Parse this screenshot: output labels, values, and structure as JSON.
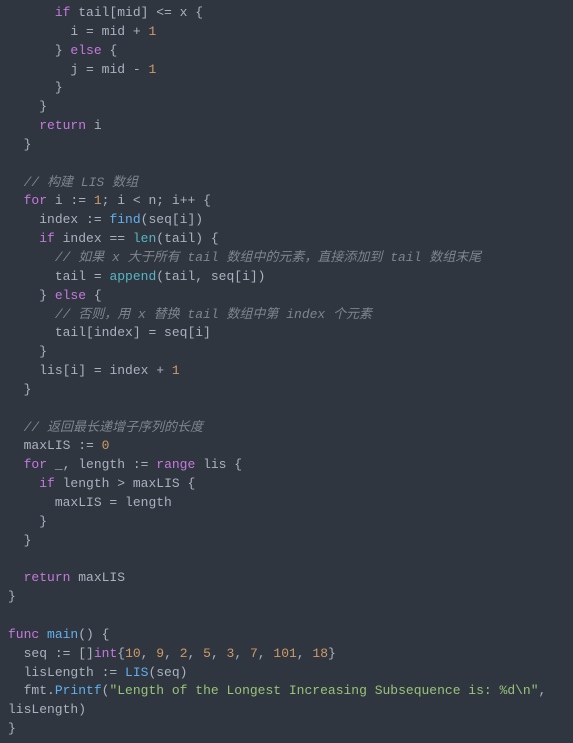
{
  "code_lines": [
    {
      "indent": 3,
      "tokens": [
        {
          "t": "keyword",
          "v": "if"
        },
        {
          "t": "plain",
          "v": " tail[mid] "
        },
        {
          "t": "operator",
          "v": "<="
        },
        {
          "t": "plain",
          "v": " x {"
        }
      ]
    },
    {
      "indent": 4,
      "tokens": [
        {
          "t": "plain",
          "v": "i "
        },
        {
          "t": "operator",
          "v": "="
        },
        {
          "t": "plain",
          "v": " mid "
        },
        {
          "t": "operator",
          "v": "+"
        },
        {
          "t": "plain",
          "v": " "
        },
        {
          "t": "number",
          "v": "1"
        }
      ]
    },
    {
      "indent": 3,
      "tokens": [
        {
          "t": "plain",
          "v": "} "
        },
        {
          "t": "keyword",
          "v": "else"
        },
        {
          "t": "plain",
          "v": " {"
        }
      ]
    },
    {
      "indent": 4,
      "tokens": [
        {
          "t": "plain",
          "v": "j "
        },
        {
          "t": "operator",
          "v": "="
        },
        {
          "t": "plain",
          "v": " mid "
        },
        {
          "t": "operator",
          "v": "-"
        },
        {
          "t": "plain",
          "v": " "
        },
        {
          "t": "number",
          "v": "1"
        }
      ]
    },
    {
      "indent": 3,
      "tokens": [
        {
          "t": "plain",
          "v": "}"
        }
      ]
    },
    {
      "indent": 2,
      "tokens": [
        {
          "t": "plain",
          "v": "}"
        }
      ]
    },
    {
      "indent": 2,
      "tokens": [
        {
          "t": "keyword",
          "v": "return"
        },
        {
          "t": "plain",
          "v": " i"
        }
      ]
    },
    {
      "indent": 1,
      "tokens": [
        {
          "t": "plain",
          "v": "}"
        }
      ]
    },
    {
      "indent": 0,
      "tokens": []
    },
    {
      "indent": 1,
      "tokens": [
        {
          "t": "comment",
          "v": "// 构建 LIS 数组"
        }
      ]
    },
    {
      "indent": 1,
      "tokens": [
        {
          "t": "keyword",
          "v": "for"
        },
        {
          "t": "plain",
          "v": " i "
        },
        {
          "t": "operator",
          "v": ":="
        },
        {
          "t": "plain",
          "v": " "
        },
        {
          "t": "number",
          "v": "1"
        },
        {
          "t": "plain",
          "v": "; i "
        },
        {
          "t": "operator",
          "v": "<"
        },
        {
          "t": "plain",
          "v": " n; i"
        },
        {
          "t": "operator",
          "v": "++"
        },
        {
          "t": "plain",
          "v": " {"
        }
      ]
    },
    {
      "indent": 2,
      "tokens": [
        {
          "t": "plain",
          "v": "index "
        },
        {
          "t": "operator",
          "v": ":="
        },
        {
          "t": "plain",
          "v": " "
        },
        {
          "t": "func-name",
          "v": "find"
        },
        {
          "t": "plain",
          "v": "(seq[i])"
        }
      ]
    },
    {
      "indent": 2,
      "tokens": [
        {
          "t": "keyword",
          "v": "if"
        },
        {
          "t": "plain",
          "v": " index "
        },
        {
          "t": "operator",
          "v": "=="
        },
        {
          "t": "plain",
          "v": " "
        },
        {
          "t": "builtin",
          "v": "len"
        },
        {
          "t": "plain",
          "v": "(tail) {"
        }
      ]
    },
    {
      "indent": 3,
      "tokens": [
        {
          "t": "comment",
          "v": "// 如果 x 大于所有 tail 数组中的元素，直接添加到 tail 数组末尾"
        }
      ]
    },
    {
      "indent": 3,
      "tokens": [
        {
          "t": "plain",
          "v": "tail "
        },
        {
          "t": "operator",
          "v": "="
        },
        {
          "t": "plain",
          "v": " "
        },
        {
          "t": "builtin",
          "v": "append"
        },
        {
          "t": "plain",
          "v": "(tail, seq[i])"
        }
      ]
    },
    {
      "indent": 2,
      "tokens": [
        {
          "t": "plain",
          "v": "} "
        },
        {
          "t": "keyword",
          "v": "else"
        },
        {
          "t": "plain",
          "v": " {"
        }
      ]
    },
    {
      "indent": 3,
      "tokens": [
        {
          "t": "comment",
          "v": "// 否则，用 x 替换 tail 数组中第 index 个元素"
        }
      ]
    },
    {
      "indent": 3,
      "tokens": [
        {
          "t": "plain",
          "v": "tail[index] "
        },
        {
          "t": "operator",
          "v": "="
        },
        {
          "t": "plain",
          "v": " seq[i]"
        }
      ]
    },
    {
      "indent": 2,
      "tokens": [
        {
          "t": "plain",
          "v": "}"
        }
      ]
    },
    {
      "indent": 2,
      "tokens": [
        {
          "t": "plain",
          "v": "lis[i] "
        },
        {
          "t": "operator",
          "v": "="
        },
        {
          "t": "plain",
          "v": " index "
        },
        {
          "t": "operator",
          "v": "+"
        },
        {
          "t": "plain",
          "v": " "
        },
        {
          "t": "number",
          "v": "1"
        }
      ]
    },
    {
      "indent": 1,
      "tokens": [
        {
          "t": "plain",
          "v": "}"
        }
      ]
    },
    {
      "indent": 0,
      "tokens": []
    },
    {
      "indent": 1,
      "tokens": [
        {
          "t": "comment",
          "v": "// 返回最长递增子序列的长度"
        }
      ]
    },
    {
      "indent": 1,
      "tokens": [
        {
          "t": "plain",
          "v": "maxLIS "
        },
        {
          "t": "operator",
          "v": ":="
        },
        {
          "t": "plain",
          "v": " "
        },
        {
          "t": "number",
          "v": "0"
        }
      ]
    },
    {
      "indent": 1,
      "tokens": [
        {
          "t": "keyword",
          "v": "for"
        },
        {
          "t": "plain",
          "v": " _, length "
        },
        {
          "t": "operator",
          "v": ":="
        },
        {
          "t": "plain",
          "v": " "
        },
        {
          "t": "keyword",
          "v": "range"
        },
        {
          "t": "plain",
          "v": " lis {"
        }
      ]
    },
    {
      "indent": 2,
      "tokens": [
        {
          "t": "keyword",
          "v": "if"
        },
        {
          "t": "plain",
          "v": " length "
        },
        {
          "t": "operator",
          "v": ">"
        },
        {
          "t": "plain",
          "v": " maxLIS {"
        }
      ]
    },
    {
      "indent": 3,
      "tokens": [
        {
          "t": "plain",
          "v": "maxLIS "
        },
        {
          "t": "operator",
          "v": "="
        },
        {
          "t": "plain",
          "v": " length"
        }
      ]
    },
    {
      "indent": 2,
      "tokens": [
        {
          "t": "plain",
          "v": "}"
        }
      ]
    },
    {
      "indent": 1,
      "tokens": [
        {
          "t": "plain",
          "v": "}"
        }
      ]
    },
    {
      "indent": 0,
      "tokens": []
    },
    {
      "indent": 1,
      "tokens": [
        {
          "t": "keyword",
          "v": "return"
        },
        {
          "t": "plain",
          "v": " maxLIS"
        }
      ]
    },
    {
      "indent": 0,
      "tokens": [
        {
          "t": "plain",
          "v": "}"
        }
      ]
    },
    {
      "indent": 0,
      "tokens": []
    },
    {
      "indent": 0,
      "tokens": [
        {
          "t": "keyword",
          "v": "func"
        },
        {
          "t": "plain",
          "v": " "
        },
        {
          "t": "func-name",
          "v": "main"
        },
        {
          "t": "plain",
          "v": "() {"
        }
      ]
    },
    {
      "indent": 1,
      "tokens": [
        {
          "t": "plain",
          "v": "seq "
        },
        {
          "t": "operator",
          "v": ":="
        },
        {
          "t": "plain",
          "v": " []"
        },
        {
          "t": "type",
          "v": "int"
        },
        {
          "t": "plain",
          "v": "{"
        },
        {
          "t": "number",
          "v": "10"
        },
        {
          "t": "plain",
          "v": ", "
        },
        {
          "t": "number",
          "v": "9"
        },
        {
          "t": "plain",
          "v": ", "
        },
        {
          "t": "number",
          "v": "2"
        },
        {
          "t": "plain",
          "v": ", "
        },
        {
          "t": "number",
          "v": "5"
        },
        {
          "t": "plain",
          "v": ", "
        },
        {
          "t": "number",
          "v": "3"
        },
        {
          "t": "plain",
          "v": ", "
        },
        {
          "t": "number",
          "v": "7"
        },
        {
          "t": "plain",
          "v": ", "
        },
        {
          "t": "number",
          "v": "101"
        },
        {
          "t": "plain",
          "v": ", "
        },
        {
          "t": "number",
          "v": "18"
        },
        {
          "t": "plain",
          "v": "}"
        }
      ]
    },
    {
      "indent": 1,
      "tokens": [
        {
          "t": "plain",
          "v": "lisLength "
        },
        {
          "t": "operator",
          "v": ":="
        },
        {
          "t": "plain",
          "v": " "
        },
        {
          "t": "func-name",
          "v": "LIS"
        },
        {
          "t": "plain",
          "v": "(seq)"
        }
      ]
    },
    {
      "indent": 1,
      "tokens": [
        {
          "t": "plain",
          "v": "fmt."
        },
        {
          "t": "func-name",
          "v": "Printf"
        },
        {
          "t": "plain",
          "v": "("
        },
        {
          "t": "string",
          "v": "\"Length of the Longest Increasing Subsequence is: %d\\n\""
        },
        {
          "t": "plain",
          "v": ", "
        }
      ]
    },
    {
      "indent": 0,
      "tokens": [
        {
          "t": "plain",
          "v": "lisLength)"
        }
      ]
    },
    {
      "indent": 0,
      "tokens": [
        {
          "t": "plain",
          "v": "}"
        }
      ]
    }
  ],
  "indent_unit": "  "
}
